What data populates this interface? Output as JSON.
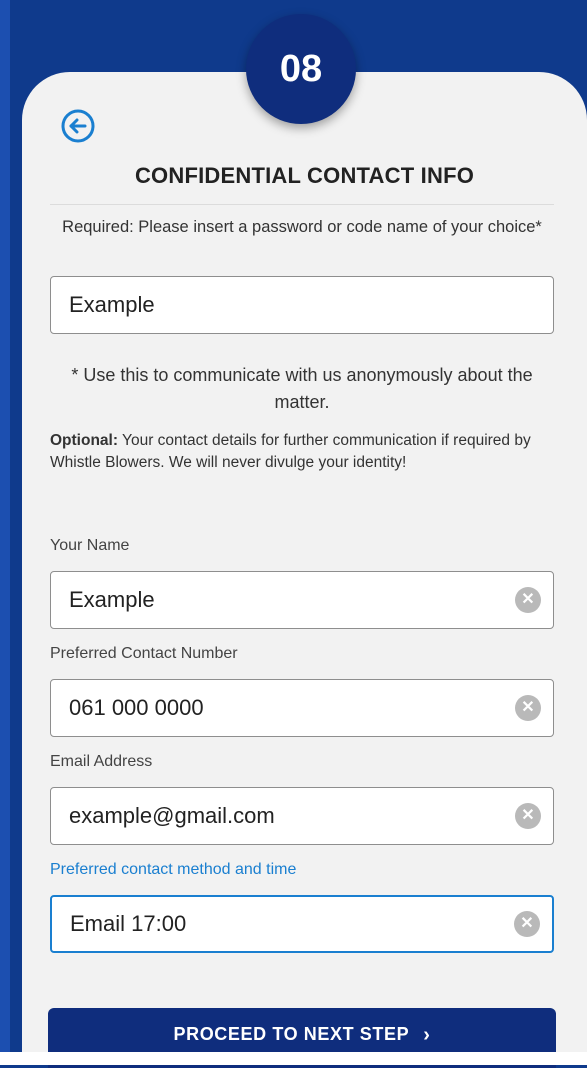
{
  "step_badge": "08",
  "title": "CONFIDENTIAL CONTACT INFO",
  "required_text": "Required: Please insert a password or code name of your choice*",
  "code_name_value": "Example",
  "anonymous_note": "* Use this to communicate with us anonymously about the matter.",
  "optional": {
    "prefix": "Optional:",
    "text": " Your contact details for further communication if required by Whistle Blowers. We will never divulge your identity!"
  },
  "fields": {
    "name": {
      "label": "Your Name",
      "value": "Example"
    },
    "phone": {
      "label": "Preferred Contact Number",
      "value": "061 000 0000"
    },
    "email": {
      "label": "Email Address",
      "value": "example@gmail.com"
    },
    "method": {
      "label": "Preferred contact method and time",
      "value": "Email 17:00"
    }
  },
  "proceed_label": "PROCEED TO NEXT STEP",
  "proceed_chevron": "›",
  "clear_glyph": "✕",
  "icons": {
    "back": "back-arrow-circle-icon",
    "clear": "clear-circle-icon",
    "chevron": "chevron-right-icon"
  },
  "colors": {
    "navy": "#0f2d7d",
    "accent_blue": "#1a7fd0",
    "card_bg": "#f2f2f2"
  }
}
